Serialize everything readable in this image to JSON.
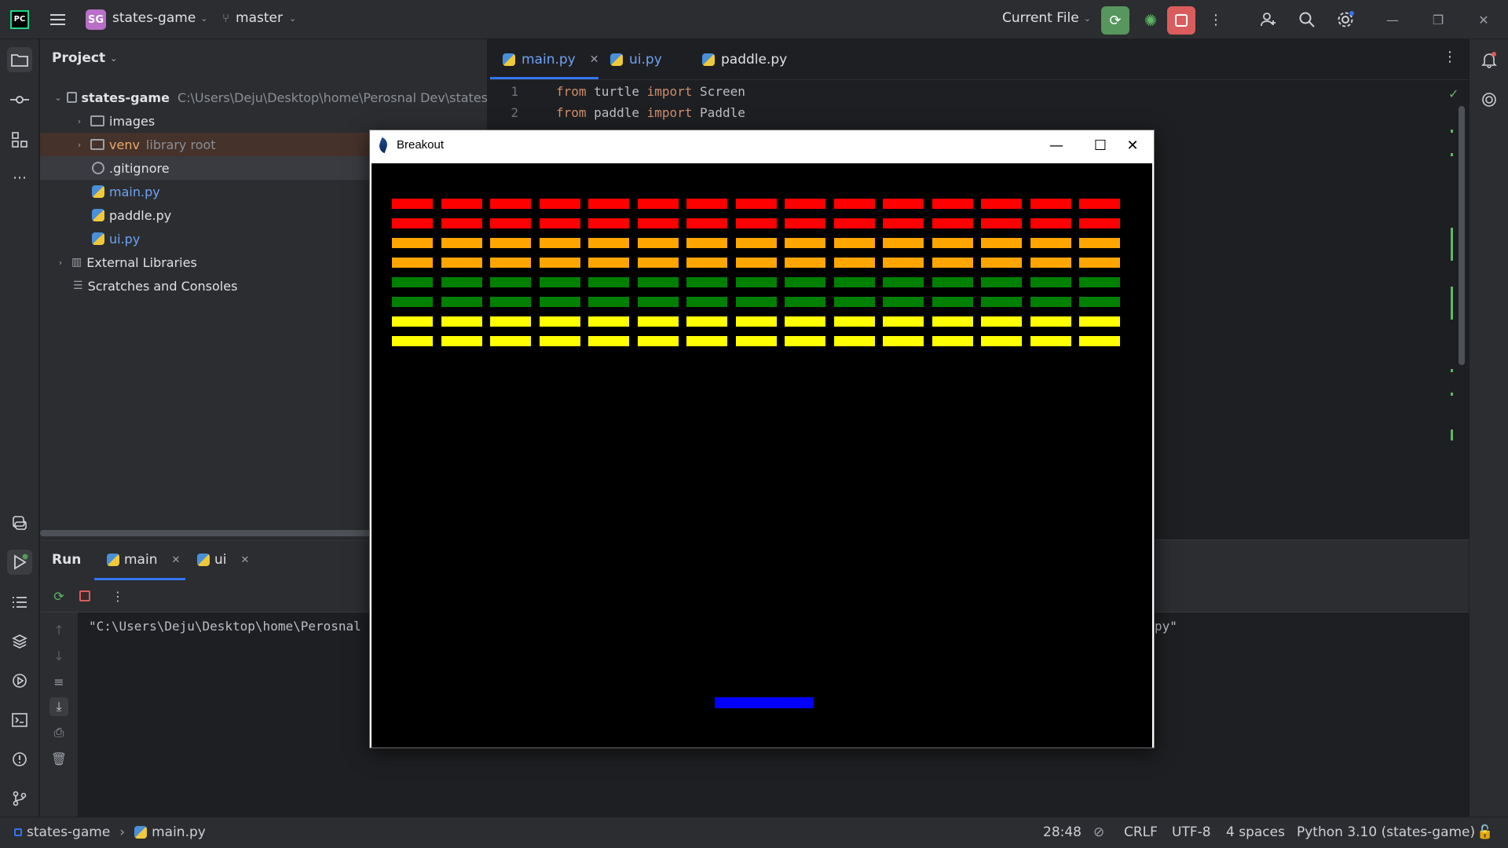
{
  "topbar": {
    "logo_text": "PC",
    "project_initials": "SG",
    "project_name": "states-game",
    "branch": "master",
    "run_config": "Current File",
    "icons": [
      "main-menu-icon",
      "branch-icon",
      "run-icon",
      "debug-icon",
      "stop-icon",
      "more-icon",
      "add-user-icon",
      "search-icon",
      "settings-icon",
      "minimize-icon",
      "restore-icon",
      "close-icon"
    ]
  },
  "project_panel": {
    "title": "Project",
    "tree": [
      {
        "label": "states-game",
        "path": "C:\\Users\\Deju\\Desktop\\home\\Perosnal Dev\\states",
        "type": "folder-root",
        "expanded": true
      },
      {
        "label": "images",
        "type": "folder"
      },
      {
        "label": "venv",
        "extra": "library root",
        "type": "folder-venv"
      },
      {
        "label": ".gitignore",
        "type": "ignore-file"
      },
      {
        "label": "main.py",
        "type": "python-file"
      },
      {
        "label": "paddle.py",
        "type": "python-file"
      },
      {
        "label": "ui.py",
        "type": "python-file"
      },
      {
        "label": "External Libraries",
        "type": "library"
      },
      {
        "label": "Scratches and Consoles",
        "type": "scratches"
      }
    ]
  },
  "editor": {
    "tabs": [
      {
        "label": "main.py",
        "active": true,
        "closable": true
      },
      {
        "label": "ui.py",
        "active": false
      },
      {
        "label": "paddle.py",
        "active": false
      }
    ],
    "lines": [
      {
        "num": "1",
        "kw1": "from",
        "mod": "turtle",
        "kw2": "import",
        "name": "Screen"
      },
      {
        "num": "2",
        "kw1": "from",
        "mod": "paddle",
        "kw2": "import",
        "name": "Paddle"
      }
    ]
  },
  "run_panel": {
    "title": "Run",
    "tabs": [
      {
        "label": "main",
        "active": true
      },
      {
        "label": "ui",
        "active": false
      }
    ],
    "console_left": "\"C:\\Users\\Deju\\Desktop\\home\\Perosnal",
    "console_right": "py\""
  },
  "statusbar": {
    "breadcrumb_project": "states-game",
    "breadcrumb_file": "main.py",
    "position": "28:48",
    "line_ending": "CRLF",
    "encoding": "UTF-8",
    "indent": "4 spaces",
    "interpreter": "Python 3.10 (states-game)"
  },
  "breakout_window": {
    "title": "Breakout",
    "rows": 8,
    "columns": 15,
    "row_colors": [
      "#ff0000",
      "#ff0000",
      "#ffa500",
      "#ffa500",
      "#008000",
      "#008000",
      "#ffff00",
      "#ffff00"
    ],
    "paddle_color": "#0000ff",
    "background": "#000000"
  }
}
